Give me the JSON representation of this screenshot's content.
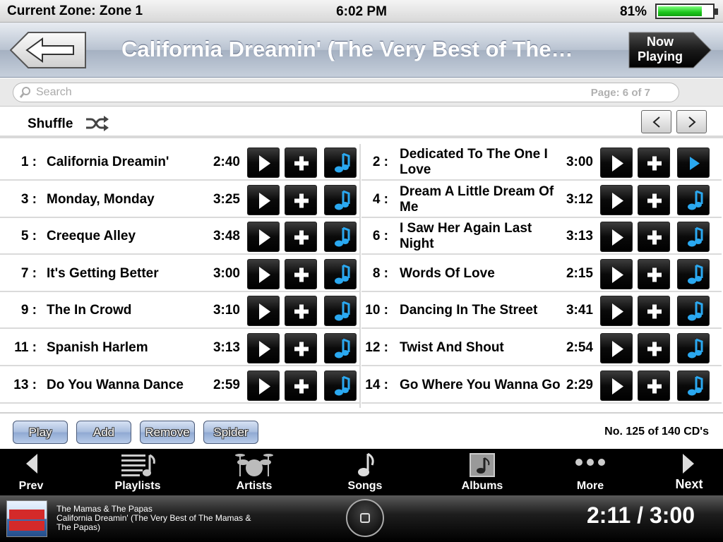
{
  "status": {
    "zone": "Current Zone: Zone 1",
    "time": "6:02 PM",
    "battery_pct": "81%",
    "battery_level": 0.81
  },
  "header": {
    "title": "California Dreamin' (The Very Best of The…",
    "now_playing_label_1": "Now",
    "now_playing_label_2": "Playing"
  },
  "search": {
    "placeholder": "Search",
    "page": "Page: 6 of 7"
  },
  "shuffle": {
    "label": "Shuffle"
  },
  "tracks": [
    {
      "num": "1 :",
      "title": "California Dreamin'",
      "duration": "2:40"
    },
    {
      "num": "2 :",
      "title": "Dedicated To The One I Love",
      "duration": "3:00",
      "playing": true
    },
    {
      "num": "3 :",
      "title": "Monday, Monday",
      "duration": "3:25"
    },
    {
      "num": "4 :",
      "title": "Dream A Little Dream Of Me",
      "duration": "3:12"
    },
    {
      "num": "5 :",
      "title": "Creeque Alley",
      "duration": "3:48"
    },
    {
      "num": "6 :",
      "title": "I Saw Her Again Last Night",
      "duration": "3:13"
    },
    {
      "num": "7 :",
      "title": "It's Getting Better",
      "duration": "3:00"
    },
    {
      "num": "8 :",
      "title": "Words Of Love",
      "duration": "2:15"
    },
    {
      "num": "9 :",
      "title": "The In Crowd",
      "duration": "3:10"
    },
    {
      "num": "10 :",
      "title": "Dancing In The Street",
      "duration": "3:41"
    },
    {
      "num": "11 :",
      "title": "Spanish Harlem",
      "duration": "3:13"
    },
    {
      "num": "12 :",
      "title": "Twist And Shout",
      "duration": "2:54"
    },
    {
      "num": "13 :",
      "title": "Do You Wanna Dance",
      "duration": "2:59"
    },
    {
      "num": "14 :",
      "title": "Go Where You Wanna Go",
      "duration": "2:29"
    }
  ],
  "actions": {
    "play": "Play",
    "add": "Add",
    "remove": "Remove",
    "spider": "Spider",
    "cd_count": "No. 125 of 140 CD's"
  },
  "tabs": {
    "prev": "Prev",
    "playlists": "Playlists",
    "artists": "Artists",
    "songs": "Songs",
    "albums": "Albums",
    "more": "More",
    "next": "Next"
  },
  "now_playing": {
    "artist": "The Mamas & The Papas",
    "title": "California Dreamin' (The Very Best of The Mamas & The Papas)",
    "time": "2:11 / 3:00",
    "art_text": "THE MAMAS & PAPAS"
  },
  "colors": {
    "accent_blue": "#2aa8f0",
    "battery_green": "#1cc61c"
  }
}
